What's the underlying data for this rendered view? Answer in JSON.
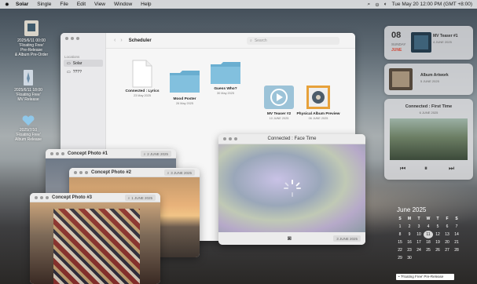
{
  "menubar": {
    "app_name": "Solar",
    "items": [
      "Single",
      "File",
      "Edit",
      "View",
      "Window",
      "Help"
    ],
    "clock": "Tue May 20 12:00 PM (GMT +8:00)"
  },
  "desktop_icons": [
    {
      "label_line1": "2025/6/11 00:00",
      "label_line2": "'Floating Free'",
      "label_line3": "Pre-Release",
      "label_line4": "& Album Pre-Order"
    },
    {
      "label_line1": "2025/6/11 18:00",
      "label_line2": "'Floating Free'",
      "label_line3": "MV Release"
    },
    {
      "label_line1": "2025/7/10",
      "label_line2": "'Floating Free'",
      "label_line3": "Album Release"
    }
  ],
  "scheduler": {
    "title": "Scheduler",
    "search_placeholder": "Search",
    "sidebar_label": "Locations",
    "sidebar_items": [
      "Solar",
      "????"
    ],
    "items": [
      {
        "name": "Connected : Lyrics",
        "date": "23 May 2025"
      },
      {
        "name": "Mood Poster",
        "date": "26 May 2025"
      },
      {
        "name": "Guess Who?",
        "date": "30 May 2025"
      },
      {
        "name": "MV Teaser #2",
        "date": "10 JUNE 2025"
      },
      {
        "name": "Physical Album Preview",
        "date": "06 JUNE 2025"
      }
    ]
  },
  "photo_windows": [
    {
      "title": "Concept Photo #1",
      "date": "2 JUNE 2025"
    },
    {
      "title": "Concept Photo #2",
      "date": "3 JUNE 2025"
    },
    {
      "title": "Concept Photo #3",
      "date": "1 JUNE 2025"
    }
  ],
  "facetime": {
    "title": "Connected : Face Time",
    "date": "3 JUNE 2025"
  },
  "widgets": {
    "date": {
      "day": "08",
      "weekday": "SUNDAY",
      "month": "JUNE"
    },
    "teaser": {
      "title": "MV Teaser #1",
      "date": "4 JUNE 2025"
    },
    "artwork": {
      "title": "Album Artwork",
      "date": "5 JUNE 2025"
    },
    "first_time": {
      "title": "Connected : First Time",
      "date": "6 JUNE 2025"
    }
  },
  "calendar": {
    "title": "June 2025",
    "weekdays": [
      "S",
      "M",
      "T",
      "W",
      "T",
      "F",
      "S"
    ],
    "rows": [
      [
        "1",
        "2",
        "3",
        "4",
        "5",
        "6",
        "7"
      ],
      [
        "8",
        "9",
        "10",
        "11",
        "12",
        "13",
        "14"
      ],
      [
        "15",
        "16",
        "17",
        "18",
        "19",
        "20",
        "21"
      ],
      [
        "22",
        "23",
        "24",
        "25",
        "26",
        "27",
        "28"
      ],
      [
        "29",
        "30",
        "",
        "",
        "",
        "",
        ""
      ]
    ],
    "event": "'Floating Free' Pre-Release"
  }
}
